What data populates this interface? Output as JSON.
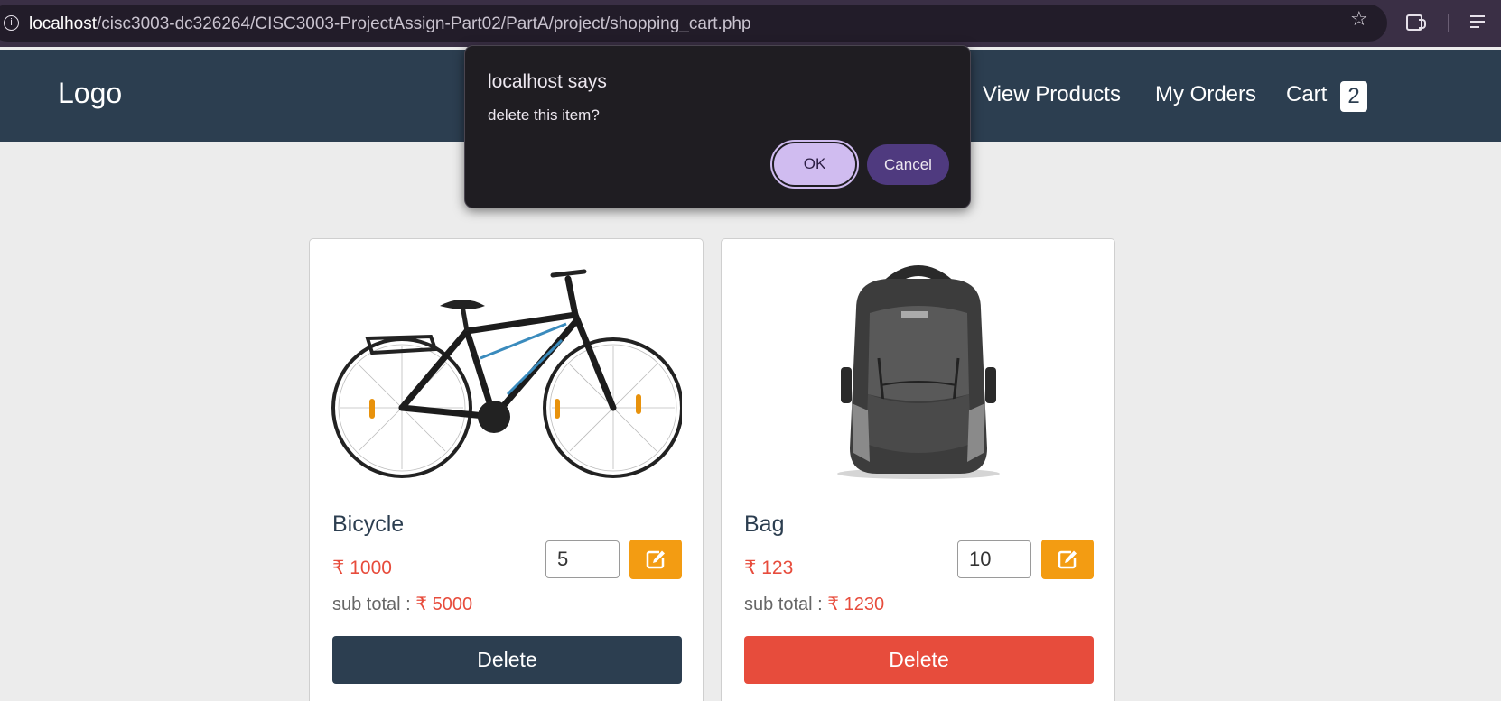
{
  "browser": {
    "url_host": "localhost",
    "url_path": "/cisc3003-dc326264/CISC3003-ProjectAssign-Part02/PartA/project/shopping_cart.php"
  },
  "navbar": {
    "logo": "Logo",
    "links": [
      "View Products",
      "My Orders",
      "Cart"
    ],
    "cart_count": "2"
  },
  "currency_symbol": "₹",
  "cart": {
    "items": [
      {
        "name": "Bicycle",
        "price": "1000",
        "quantity": "5",
        "subtotal_label": "sub total :",
        "subtotal": "5000",
        "delete_label": "Delete",
        "delete_color": "#2c3e50"
      },
      {
        "name": "Bag",
        "price": "123",
        "quantity": "10",
        "subtotal_label": "sub total :",
        "subtotal": "1230",
        "delete_label": "Delete",
        "delete_color": "#e74c3c"
      }
    ]
  },
  "dialog": {
    "title": "localhost says",
    "message": "delete this item?",
    "ok_label": "OK",
    "cancel_label": "Cancel"
  },
  "colors": {
    "navbar": "#2c3e50",
    "accent_orange": "#f39c12",
    "price_red": "#e74c3c",
    "dialog_ok": "#d0bcf0",
    "dialog_cancel": "#4f3a7f"
  },
  "icons": {
    "site_info": "info-icon",
    "bookmark": "star-icon",
    "extensions": "puzzle-icon",
    "media": "media-queue-icon",
    "edit": "edit-icon"
  }
}
